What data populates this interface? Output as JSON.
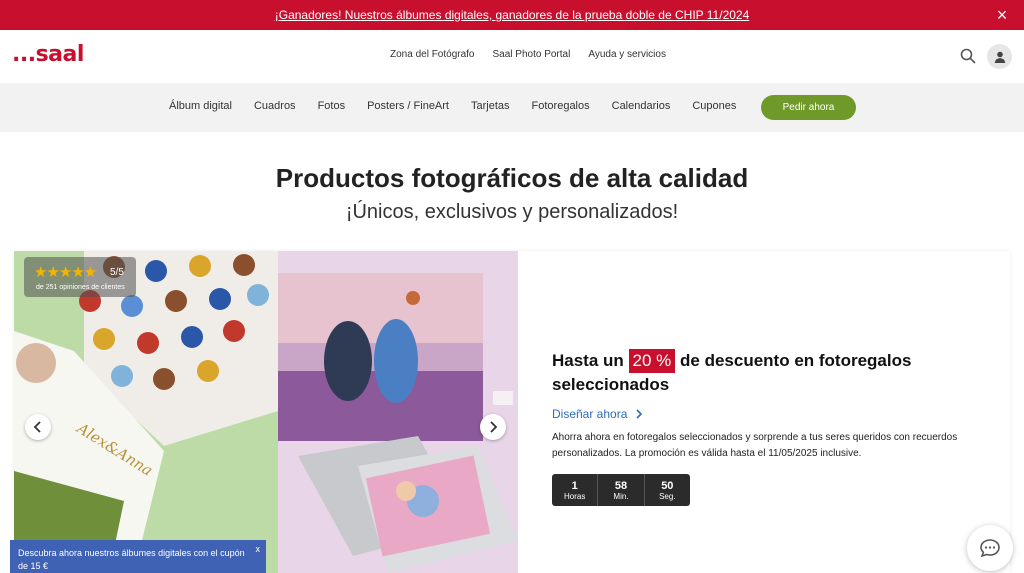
{
  "promo": {
    "text": "¡Ganadores! Nuestros álbumes digitales, ganadores de la prueba doble de CHIP 11/2024",
    "close": "×"
  },
  "header": {
    "logo": "...saal",
    "top_links": [
      "Zona del Fotógrafo",
      "Saal Photo Portal",
      "Ayuda y servicios"
    ],
    "icons": {
      "search": "search-icon",
      "account": "user-icon"
    }
  },
  "nav": {
    "categories": [
      "Álbum digital",
      "Cuadros",
      "Fotos",
      "Posters / FineArt",
      "Tarjetas",
      "Fotoregalos",
      "Calendarios",
      "Cupones"
    ],
    "order_button": "Pedir ahora"
  },
  "hero": {
    "title": "Productos fotográficos de alta calidad",
    "subtitle": "¡Únicos, exclusivos y personalizados!"
  },
  "banner": {
    "rating": {
      "stars": "★★★★★",
      "score": "5/5",
      "reviews": "de 251 opiniones de clientes"
    },
    "album_text": "Alex&Anna",
    "offer": {
      "title_pre": "Hasta un",
      "discount": "20 %",
      "title_post": "de descuento en fotoregalos seleccionados",
      "link": "Diseñar ahora",
      "description": "Ahorra ahora en fotoregalos seleccionados y sorprende a tus seres queridos con recuerdos personalizados. La promoción es válida hasta el 11/05/2025 inclusive."
    },
    "countdown": [
      {
        "value": "1",
        "label": "Horas"
      },
      {
        "value": "58",
        "label": "Min."
      },
      {
        "value": "50",
        "label": "Seg."
      }
    ]
  },
  "coupon_popup": {
    "text": "Descubra ahora nuestros álbumes digitales con el cupón de 15 €",
    "close": "x"
  },
  "colors": {
    "brand_red": "#c8102e",
    "order_green": "#6f9a2a",
    "popup_blue": "#3f62b5",
    "link_blue": "#2d6db5"
  }
}
